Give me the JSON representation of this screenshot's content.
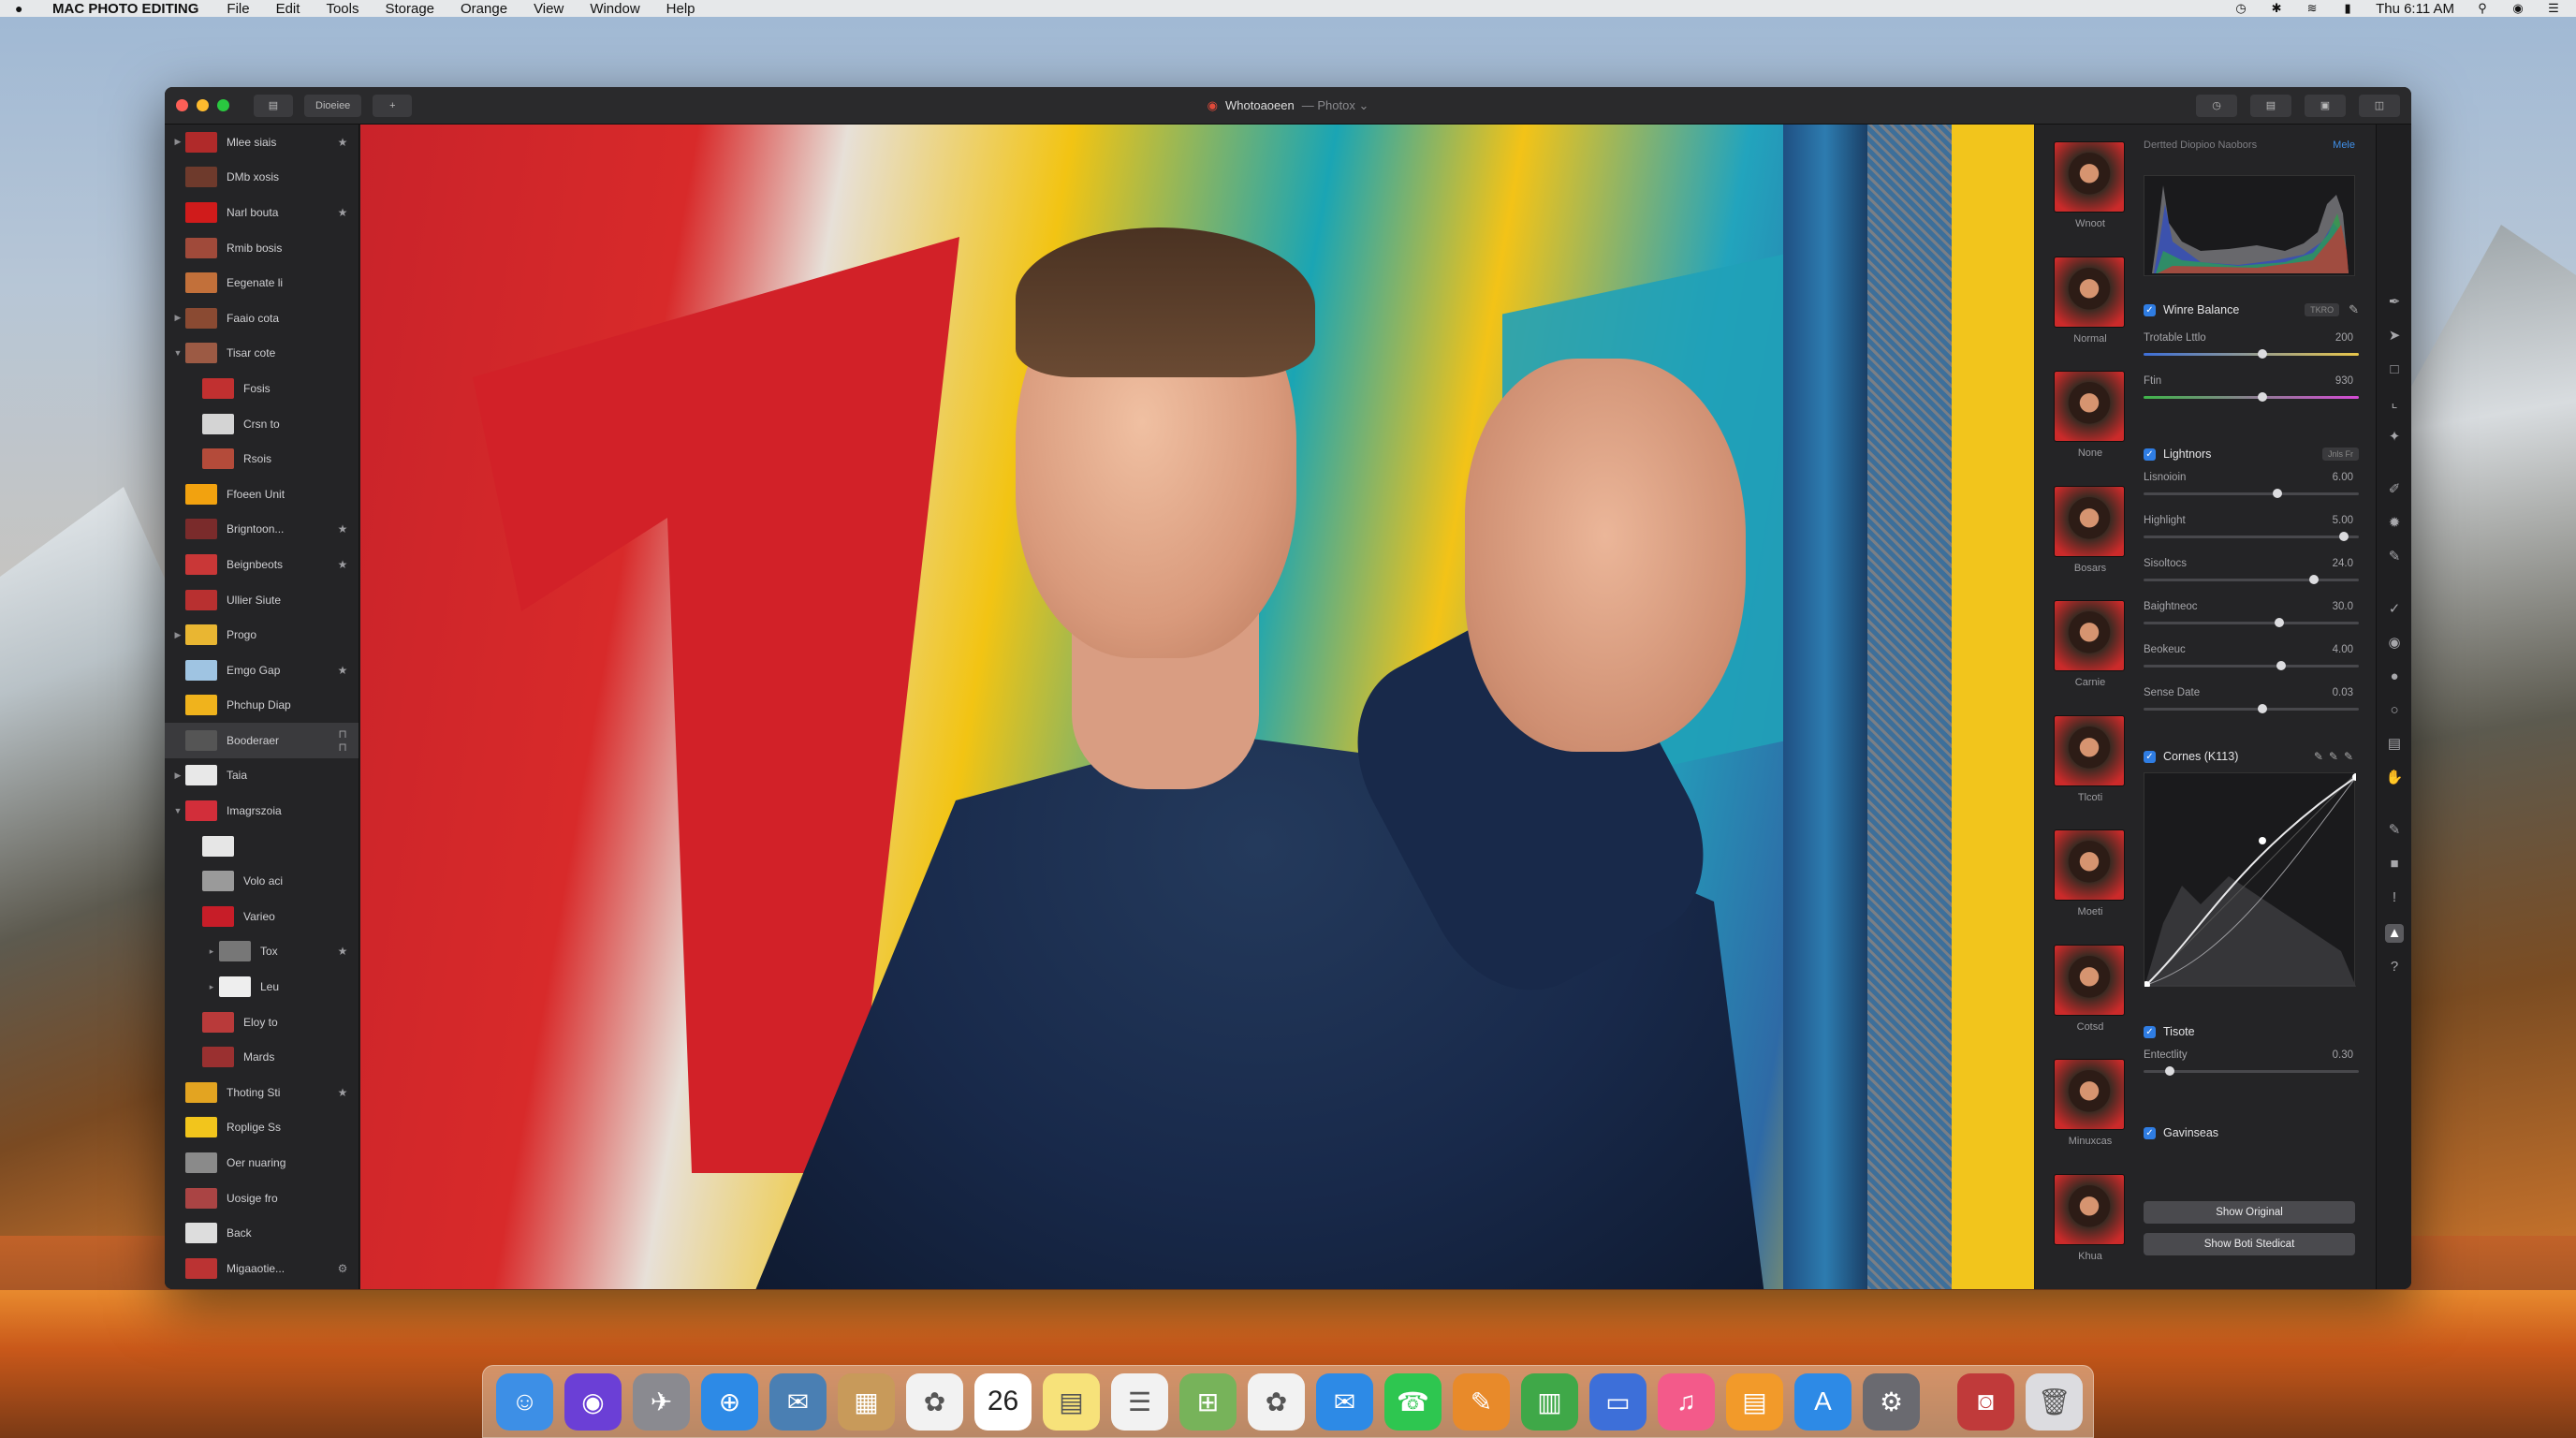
{
  "menubar": {
    "apple": "",
    "app": "MAC PHOTO EDITING",
    "items": [
      "File",
      "Edit",
      "Tools",
      "Storage",
      "Orange",
      "View",
      "Window",
      "Help"
    ],
    "clock": "Thu 6:11 AM"
  },
  "titlebar": {
    "left_button": "Dioeiee",
    "doc_title": "Whotoaoeen",
    "doc_sub": "— Photox ⌄"
  },
  "layers": [
    {
      "name": "Mlee siais",
      "disclosure": "▶",
      "badge": "★",
      "color": "#b02a2a"
    },
    {
      "name": "DMb xosis",
      "disclosure": "",
      "badge": "",
      "color": "#6e3a2c"
    },
    {
      "name": "Narl bouta",
      "disclosure": "",
      "badge": "★",
      "color": "#d01b1b"
    },
    {
      "name": "Rmib bosis",
      "disclosure": "",
      "badge": "",
      "color": "#a04a3a"
    },
    {
      "name": "Eegenate li",
      "disclosure": "",
      "badge": "",
      "color": "#c2703a"
    },
    {
      "name": "Faaio cota",
      "disclosure": "▶",
      "badge": "",
      "color": "#8a4a32"
    },
    {
      "name": "Tisar cote",
      "disclosure": "▼",
      "badge": "",
      "color": "#9c5a44"
    },
    {
      "name": "Fosis",
      "disclosure": "",
      "badge": "",
      "color": "#c13030",
      "indent": 1
    },
    {
      "name": "Crsn to",
      "disclosure": "",
      "badge": "",
      "color": "#d4d4d4",
      "indent": 1
    },
    {
      "name": "Rsois",
      "disclosure": "",
      "badge": "",
      "color": "#b44b3a",
      "indent": 1
    },
    {
      "name": "Ffoeen Unit",
      "disclosure": "",
      "badge": "",
      "color": "#f2a20f"
    },
    {
      "name": "Brigntoon...",
      "disclosure": "",
      "badge": "★",
      "color": "#7a2b2b"
    },
    {
      "name": "Beignbeots",
      "disclosure": "",
      "badge": "★",
      "color": "#c93737"
    },
    {
      "name": "Ullier Siute",
      "disclosure": "",
      "badge": "",
      "color": "#b83030"
    },
    {
      "name": "Progo",
      "disclosure": "▶",
      "badge": "",
      "color": "#e9b632"
    },
    {
      "name": "Emgo Gap",
      "disclosure": "",
      "badge": "★",
      "color": "#9fc4e2"
    },
    {
      "name": "Phchup Diap",
      "disclosure": "",
      "badge": "",
      "color": "#f0b31c"
    },
    {
      "name": "Booderaer",
      "disclosure": "",
      "badge": "⊓ ⊓",
      "color": "#555",
      "selected": true
    },
    {
      "name": "Taia",
      "disclosure": "▶",
      "badge": "",
      "color": "#e8e8e8"
    },
    {
      "name": "Imagrszoia",
      "disclosure": "▼",
      "badge": "",
      "color": "#d22e3a"
    },
    {
      "name": "",
      "disclosure": "",
      "badge": "",
      "color": "#e6e6e6",
      "indent": 1
    },
    {
      "name": "Volo aci",
      "disclosure": "",
      "badge": "",
      "color": "#9a9a9a",
      "indent": 1
    },
    {
      "name": "Varieo",
      "disclosure": "",
      "badge": "",
      "color": "#c71d28",
      "indent": 1
    },
    {
      "name": "Tox",
      "disclosure": "▸",
      "badge": "★",
      "color": "#777",
      "indent": 2
    },
    {
      "name": "Leu",
      "disclosure": "▸",
      "badge": "",
      "color": "#eee",
      "indent": 2
    },
    {
      "name": "Eloy to",
      "disclosure": "",
      "badge": "",
      "color": "#b93a3a",
      "indent": 1
    },
    {
      "name": "Mards",
      "disclosure": "",
      "badge": "",
      "color": "#9a3030",
      "indent": 1
    },
    {
      "name": "Thoting Sti",
      "disclosure": "",
      "badge": "★",
      "color": "#e3a421"
    },
    {
      "name": "Roplige Ss",
      "disclosure": "",
      "badge": "",
      "color": "#f2c51c"
    },
    {
      "name": "Oer nuaring",
      "disclosure": "",
      "badge": "",
      "color": "#8a8a8a"
    },
    {
      "name": "Uosige fro",
      "disclosure": "",
      "badge": "",
      "color": "#a44"
    },
    {
      "name": "Back",
      "disclosure": "",
      "badge": "",
      "color": "#ddd"
    },
    {
      "name": "Migaaotie...",
      "disclosure": "",
      "badge": "⚙",
      "color": "#b33"
    }
  ],
  "presets": [
    "Wnoot",
    "Normal",
    "None",
    "Bosars",
    "Carnie",
    "Tlcoti",
    "Moeti",
    "Cotsd",
    "Minuxcas",
    "Khua"
  ],
  "adjust": {
    "histogram_title": "Dertted Diopioo Naobors",
    "histogram_link": "Mele",
    "white_balance": {
      "title": "Winre Balance",
      "pill": "TKRO",
      "sliders": [
        {
          "label": "Trotable Lttlo",
          "value": "200",
          "pos": 0.55
        },
        {
          "label": "Ftin",
          "value": "930",
          "pos": 0.55
        }
      ]
    },
    "light": {
      "title": "Lightnors",
      "pill": "Jnls Fr",
      "sliders": [
        {
          "label": "Lisnoioin",
          "value": "6.00",
          "pos": 0.62
        },
        {
          "label": "Highlight",
          "value": "5.00",
          "pos": 0.93
        },
        {
          "label": "Sisoltocs",
          "value": "24.0",
          "pos": 0.79
        },
        {
          "label": "Baightneoc",
          "value": "30.0",
          "pos": 0.63
        },
        {
          "label": "Beokeuc",
          "value": "4.00",
          "pos": 0.64
        },
        {
          "label": "Sense Date",
          "value": "0.03",
          "pos": 0.55
        }
      ]
    },
    "curves": {
      "title": "Cornes (K113)"
    },
    "texture": {
      "title": "Tisote",
      "sliders": [
        {
          "label": "Entectlity",
          "value": "0.30",
          "pos": 0.12
        }
      ]
    },
    "gavin": {
      "title": "Gavinseas"
    },
    "buttons": [
      "Show Original",
      "Show Boti Stedicat"
    ]
  },
  "dock": [
    "Finder",
    "Siri",
    "Launchpad",
    "Safari",
    "Preview",
    "Notes",
    "Photos",
    "Calendar",
    "Stickies",
    "Reminders",
    "Maps",
    "Photos",
    "Messages",
    "FaceTime",
    "Pages",
    "Numbers",
    "Keynote",
    "iTunes",
    "iBooks",
    "App Store",
    "System Preferences",
    "Photo Booth",
    "Trash"
  ],
  "calendar_day": "26"
}
